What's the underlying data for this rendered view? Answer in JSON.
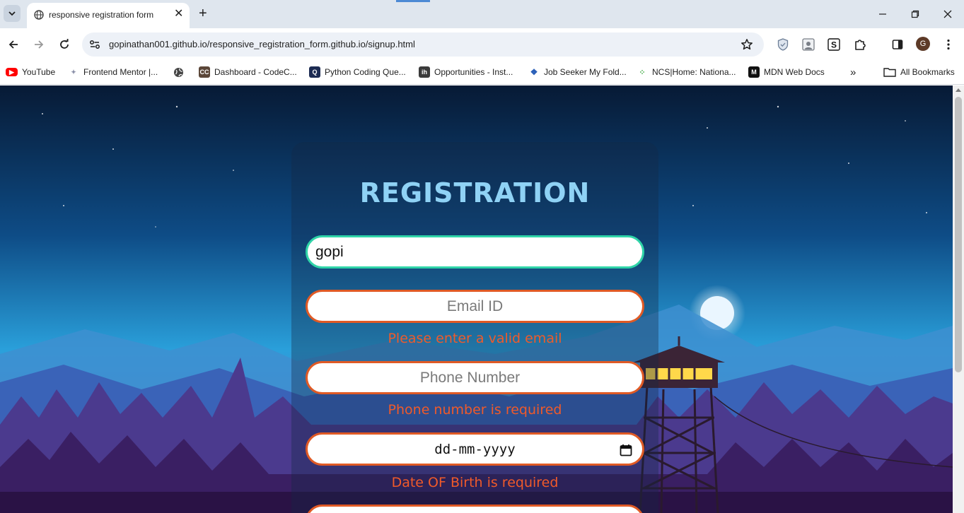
{
  "browser": {
    "tab": {
      "title": "responsive registration form"
    },
    "url": "gopinathan001.github.io/responsive_registration_form.github.io/signup.html",
    "profile_initial": "G",
    "bookmarks": [
      {
        "label": "YouTube",
        "icon": "youtube-icon",
        "color": "#ff0000"
      },
      {
        "label": "Frontend Mentor |...",
        "icon": "frontend-mentor-icon",
        "color": "#8a8fa8"
      },
      {
        "label": "",
        "icon": "globe-icon",
        "color": "#444444"
      },
      {
        "label": "Dashboard - CodeC...",
        "icon": "codechef-icon",
        "color": "#5b4638"
      },
      {
        "label": "Python Coding Que...",
        "icon": "python-coding-icon",
        "color": "#1c2b52"
      },
      {
        "label": "Opportunities - Inst...",
        "icon": "internshala-icon",
        "color": "#3b3b3b"
      },
      {
        "label": "Job Seeker My Fold...",
        "icon": "job-seeker-icon",
        "color": "#2a5fb8"
      },
      {
        "label": "NCS|Home: Nationa...",
        "icon": "ncs-icon",
        "color": "#4caf50"
      },
      {
        "label": "MDN Web Docs",
        "icon": "mdn-icon",
        "color": "#111111"
      }
    ],
    "all_bookmarks_label": "All Bookmarks"
  },
  "form": {
    "heading": "REGISTRATION",
    "name_value": "gopi",
    "email_placeholder": "Email ID",
    "email_error": "Please enter a valid email",
    "phone_placeholder": "Phone Number",
    "phone_error": "Phone number is required",
    "dob_placeholder": "dd-mm-yyyy",
    "dob_error": "Date OF Birth is required"
  },
  "colors": {
    "error_border": "#e05a25",
    "valid_border": "#2fd4a8",
    "error_text": "#f05a2a",
    "heading": "#8fd2f5"
  }
}
